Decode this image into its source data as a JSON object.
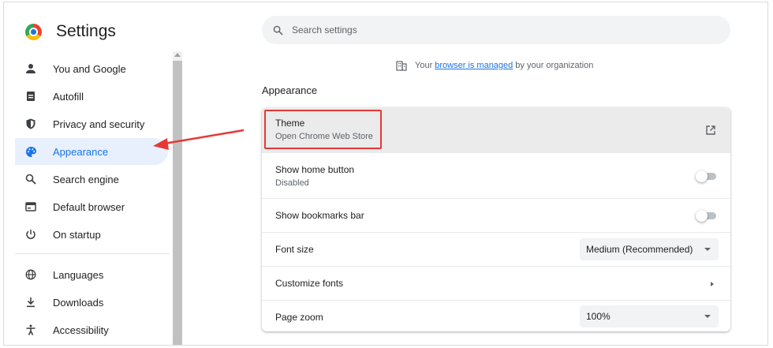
{
  "app": {
    "title": "Settings"
  },
  "search": {
    "placeholder": "Search settings",
    "value": ""
  },
  "managed_notice": {
    "prefix": "Your",
    "link": "browser is managed",
    "suffix": "by your organization"
  },
  "sidebar": {
    "items": [
      {
        "label": "You and Google",
        "icon": "person-icon",
        "active": false
      },
      {
        "label": "Autofill",
        "icon": "clipboard-icon",
        "active": false
      },
      {
        "label": "Privacy and security",
        "icon": "shield-icon",
        "active": false
      },
      {
        "label": "Appearance",
        "icon": "palette-icon",
        "active": true
      },
      {
        "label": "Search engine",
        "icon": "search-icon",
        "active": false
      },
      {
        "label": "Default browser",
        "icon": "browser-window-icon",
        "active": false
      },
      {
        "label": "On startup",
        "icon": "power-icon",
        "active": false
      },
      {
        "label": "Languages",
        "icon": "globe-icon",
        "active": false
      },
      {
        "label": "Downloads",
        "icon": "download-icon",
        "active": false
      },
      {
        "label": "Accessibility",
        "icon": "accessibility-icon",
        "active": false
      }
    ]
  },
  "appearance": {
    "section_title": "Appearance",
    "theme": {
      "label": "Theme",
      "sublabel": "Open Chrome Web Store"
    },
    "home_button": {
      "label": "Show home button",
      "sublabel": "Disabled",
      "enabled": false
    },
    "bookmarks_bar": {
      "label": "Show bookmarks bar",
      "enabled": false
    },
    "font_size": {
      "label": "Font size",
      "value": "Medium (Recommended)"
    },
    "customize_fonts": {
      "label": "Customize fonts"
    },
    "page_zoom": {
      "label": "Page zoom",
      "value": "100%"
    }
  },
  "colors": {
    "accent": "#1a73e8",
    "highlight": "#e53935",
    "active_bg": "#e8f0fe"
  }
}
